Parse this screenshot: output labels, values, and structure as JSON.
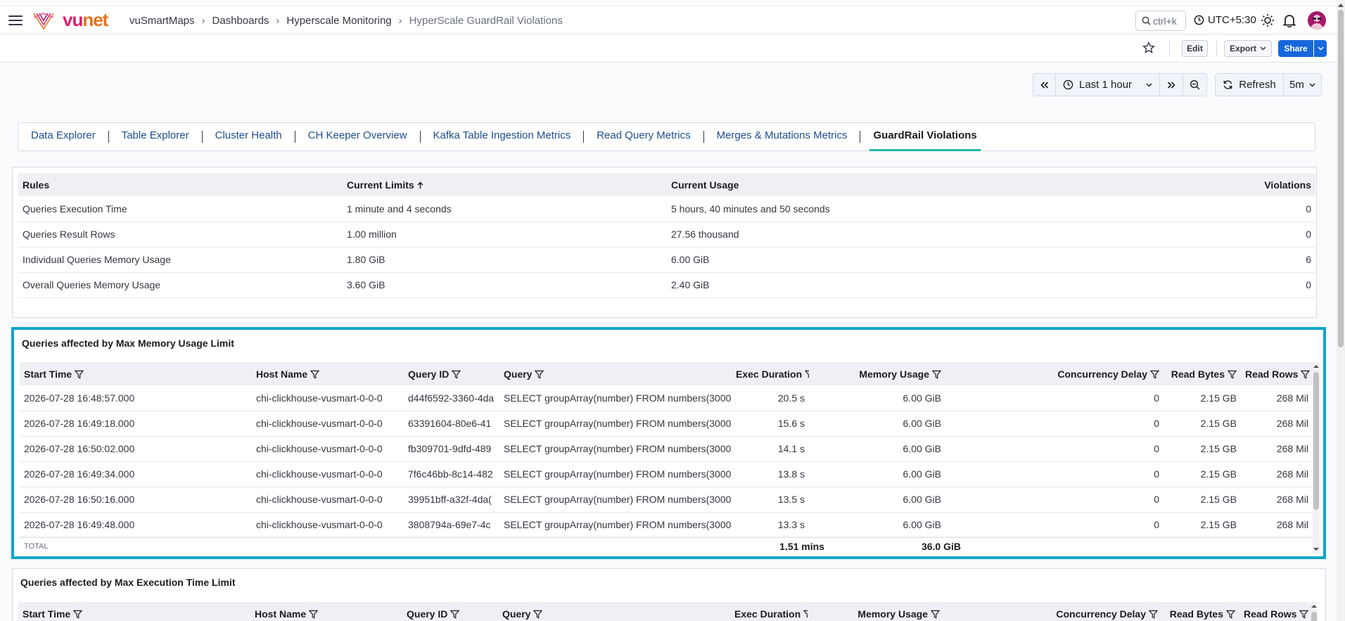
{
  "header": {
    "brand_vu": "vu",
    "brand_net": "net",
    "breadcrumbs": [
      "vuSmartMaps",
      "Dashboards",
      "Hyperscale Monitoring",
      "HyperScale GuardRail Violations"
    ],
    "search_shortcut": "ctrl+k",
    "timezone": "UTC+5:30",
    "icons": [
      "menu-icon",
      "search-icon",
      "clock-icon",
      "sun-icon",
      "bell-icon"
    ]
  },
  "toolbar": {
    "edit": "Edit",
    "export": "Export",
    "share": "Share"
  },
  "time": {
    "range": "Last 1 hour",
    "refresh": "Refresh",
    "interval": "5m"
  },
  "tabs": [
    {
      "label": "Data Explorer"
    },
    {
      "label": "Table Explorer"
    },
    {
      "label": "Cluster Health"
    },
    {
      "label": "CH Keeper Overview"
    },
    {
      "label": "Kafka Table Ingestion Metrics"
    },
    {
      "label": "Read Query Metrics"
    },
    {
      "label": "Merges & Mutations Metrics"
    },
    {
      "label": "GuardRail Violations",
      "active": true
    }
  ],
  "rules_table": {
    "headers": [
      "Rules",
      "Current Limits",
      "Current Usage",
      "Violations"
    ],
    "rows": [
      [
        "Queries Execution Time",
        "1 minute and 4 seconds",
        "5 hours, 40 minutes and 50 seconds",
        "0"
      ],
      [
        "Queries Result Rows",
        "1.00 million",
        "27.56 thousand",
        "0"
      ],
      [
        "Individual Queries Memory Usage",
        "1.80 GiB",
        "6.00 GiB",
        "6"
      ],
      [
        "Overall Queries Memory Usage",
        "3.60 GiB",
        "2.40 GiB",
        "0"
      ]
    ]
  },
  "memory_panel": {
    "title": "Queries affected by Max Memory Usage Limit",
    "headers": [
      "Start Time",
      "Host Name",
      "Query ID",
      "Query",
      "Exec Duration",
      "Memory Usage",
      "Concurrency Delay",
      "Read Bytes",
      "Read Rows"
    ],
    "rows": [
      [
        "2026-07-28 16:48:57.000",
        "chi-clickhouse-vusmart-0-0-0",
        "d44f6592-3360-4da",
        "SELECT groupArray(number) FROM numbers(3000",
        "20.5 s",
        "6.00 GiB",
        "0",
        "2.15 GB",
        "268 Mil"
      ],
      [
        "2026-07-28 16:49:18.000",
        "chi-clickhouse-vusmart-0-0-0",
        "63391604-80e6-41",
        "SELECT groupArray(number) FROM numbers(3000",
        "15.6 s",
        "6.00 GiB",
        "0",
        "2.15 GB",
        "268 Mil"
      ],
      [
        "2026-07-28 16:50:02.000",
        "chi-clickhouse-vusmart-0-0-0",
        "fb309701-9dfd-489",
        "SELECT groupArray(number) FROM numbers(3000",
        "14.1 s",
        "6.00 GiB",
        "0",
        "2.15 GB",
        "268 Mil"
      ],
      [
        "2026-07-28 16:49:34.000",
        "chi-clickhouse-vusmart-0-0-0",
        "7f6c46bb-8c14-482",
        "SELECT groupArray(number) FROM numbers(3000",
        "13.8 s",
        "6.00 GiB",
        "0",
        "2.15 GB",
        "268 Mil"
      ],
      [
        "2026-07-28 16:50:16.000",
        "chi-clickhouse-vusmart-0-0-0",
        "39951bff-a32f-4da(",
        "SELECT groupArray(number) FROM numbers(3000",
        "13.5 s",
        "6.00 GiB",
        "0",
        "2.15 GB",
        "268 Mil"
      ],
      [
        "2026-07-28 16:49:48.000",
        "chi-clickhouse-vusmart-0-0-0",
        "3808794a-69e7-4c",
        "SELECT groupArray(number) FROM numbers(3000",
        "13.3 s",
        "6.00 GiB",
        "0",
        "2.15 GB",
        "268 Mil"
      ]
    ],
    "total_label": "TOTAL",
    "total_exec": "1.51 mins",
    "total_memory": "36.0 GiB",
    "highlight_color": "#0ea5c9"
  },
  "exec_panel": {
    "title": "Queries affected by Max Execution Time Limit",
    "headers": [
      "Start Time",
      "Host Name",
      "Query ID",
      "Query",
      "Exec Duration",
      "Memory Usage",
      "Concurrency Delay",
      "Read Bytes",
      "Read Rows"
    ]
  }
}
